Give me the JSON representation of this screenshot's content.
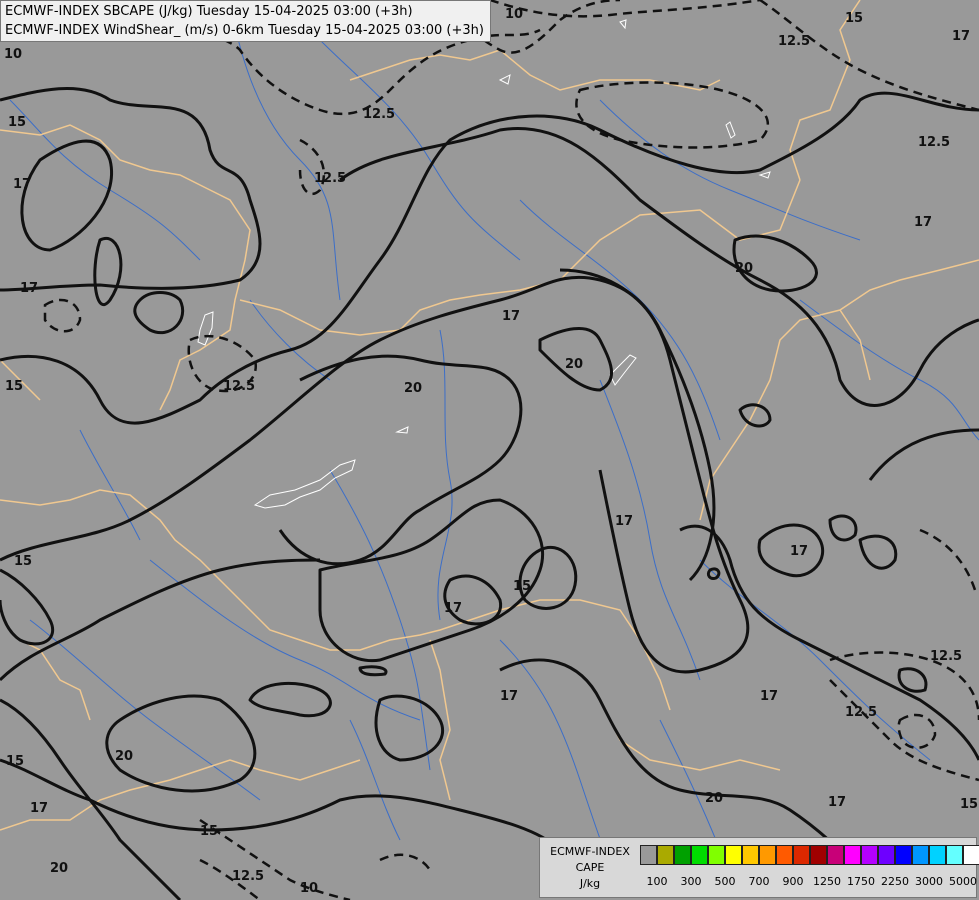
{
  "header": {
    "line1": "ECMWF-INDEX SBCAPE (J/kg) Tuesday 15-04-2025 03:00 (+3h)",
    "line2": "ECMWF-INDEX WindShear_ (m/s) 0-6km Tuesday 15-04-2025 03:00 (+3h)"
  },
  "legend": {
    "title_line1": "ECMWF-INDEX",
    "title_line2": "CAPE",
    "title_line3": "J/kg",
    "colors": [
      "#999999",
      "#aaaa00",
      "#00a000",
      "#00dc00",
      "#80ff00",
      "#ffff00",
      "#ffc800",
      "#ff9900",
      "#ff5a00",
      "#dc2800",
      "#a00000",
      "#c80078",
      "#ff00ff",
      "#b400ff",
      "#6e00ff",
      "#0000ff",
      "#0096ff",
      "#00d2ff",
      "#64ffff",
      "#ffffff"
    ],
    "tick_labels": [
      "100",
      "300",
      "500",
      "700",
      "900",
      "1250",
      "1750",
      "2250",
      "3000",
      "5000"
    ]
  },
  "contour_labels": [
    "10",
    "12.5",
    "15",
    "17",
    "20"
  ],
  "colors": {
    "background": "#999999",
    "borders": "#f0c890",
    "rivers": "#3c6ec8",
    "contours": "#111111",
    "lakes": "#ffffff"
  }
}
